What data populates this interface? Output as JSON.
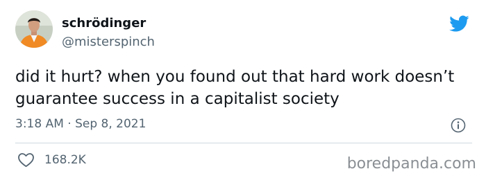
{
  "tweet": {
    "author": {
      "display_name": "schrödinger",
      "handle": "@misterspinch",
      "avatar_icon": "profile-photo"
    },
    "brand_icon": "twitter-bird-icon",
    "brand_color": "#1d9bf0",
    "text": "did it hurt? when you found out that hard work doesn’t guarantee success in a capitalist society",
    "timestamp": "3:18 AM · Sep 8, 2021",
    "info_icon": "info-icon",
    "likes": {
      "icon": "heart-icon",
      "count": "168.2K"
    }
  },
  "watermark": {
    "text": "boredpanda.com"
  }
}
